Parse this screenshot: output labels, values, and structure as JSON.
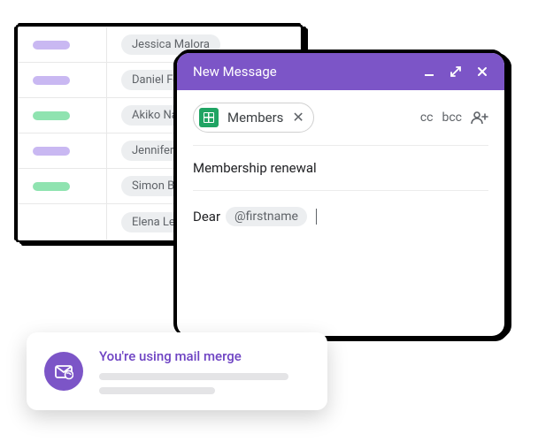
{
  "colors": {
    "purple": "#c9b8f2",
    "green": "#8fe3b0",
    "brand": "#7c55c7"
  },
  "table": {
    "rows": [
      {
        "pill_color": "purple",
        "name": "Jessica Malora"
      },
      {
        "pill_color": "purple",
        "name": "Daniel Ferr"
      },
      {
        "pill_color": "green",
        "name": "Akiko Naka"
      },
      {
        "pill_color": "purple",
        "name": "Jennifer Ac"
      },
      {
        "pill_color": "green",
        "name": "Simon Balli"
      },
      {
        "pill_color": "",
        "name": "Elena Lee"
      }
    ]
  },
  "compose": {
    "title": "New Message",
    "recipient_label": "Members",
    "cc": "cc",
    "bcc": "bcc",
    "subject": "Membership renewal",
    "body_prefix": "Dear",
    "token": "@firstname"
  },
  "banner": {
    "title": "You're using mail merge"
  }
}
